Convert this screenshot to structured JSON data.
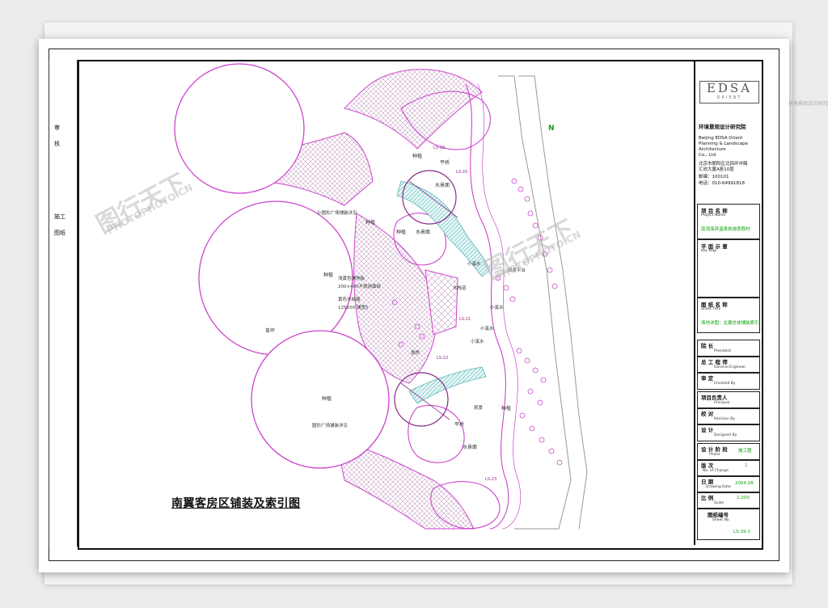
{
  "drawing": {
    "title": "南翼客房区铺装及索引图",
    "north": "N",
    "labels": {
      "plant1": "种植",
      "plant2": "种植",
      "plant3": "种植",
      "plant4": "种植",
      "plant5": "种植",
      "plant6": "种植",
      "water1": "水景面",
      "water2": "水景面",
      "water3": "水景面",
      "platform1": "平桥",
      "platform2": "平桥",
      "detail1": "小圆形广场铺装详见",
      "detail2": "圆形广场铺装详见",
      "note1": "浅黄色铺地板",
      "note2": "200×400不规则面砖",
      "note3": "黄色木板路",
      "note4": "125X50 铺宽5",
      "grass": "草坪",
      "stream1": "小溪水",
      "stream2": "小溪水",
      "stream3": "小溪水",
      "stream4": "小溪水",
      "wood": "木栈道",
      "overlook": "观景平台",
      "overlook2": "观景",
      "scenery": "景桥",
      "ref1": "LS-19",
      "ref2": "LS-20",
      "ref3": "LS-21",
      "ref4": "LS-22",
      "ref5": "LS-23"
    }
  },
  "titleblock": {
    "logo": "EDSA",
    "logo_sub": "ORIENT",
    "firm_cn": "环境景观设计研究院",
    "firm_en1": "Beijing EDSA Orient",
    "firm_en2": "Planning & Landscape",
    "firm_en3": "Architecture",
    "firm_en4": "Co., Ltd",
    "addr1": "北京市朝阳区北四环中路",
    "addr2": "汇欣大厦A座10层",
    "zip": "邮编：100101",
    "tel": "电话：010-64991818",
    "project_cn": "项 目 名 称",
    "project_en": "Project Name",
    "project_val": "南湾海滨温泉旅游度假村",
    "keymap_cn": "平 面 示 意",
    "keymap_en": "Key Map",
    "sheet_cn": "图 纸 名 称",
    "sheet_en": "Sheet Title",
    "sheet_val": "场地详图：北翼总体铺装索引",
    "president_cn": "院  长",
    "president_en": "President",
    "chief_cn": "总 工 程 师",
    "chief_en": "General Engineer",
    "review_cn": "审    定",
    "review_en": "Checked By",
    "principal_cn": "项目负责人",
    "principal_en": "Principal",
    "revision_cn": "校    对",
    "revision_en": "Revision By",
    "design_cn": "设    计",
    "design_en": "Designed By",
    "phase_cn": "设 计 阶 段",
    "phase_en": "Phase",
    "phase_val": "施工图",
    "change_cn": "版    次",
    "change_en": "No. of Change",
    "change_val": "1",
    "date_cn": "日    期",
    "date_en": "Drawing Date",
    "date_val": "2004.08",
    "scale_cn": "比    例",
    "scale_en": "Scale",
    "scale_val": "1:200",
    "sheetno_cn": "图纸编号",
    "sheetno_en": "Sheet No.",
    "sheetno_val": "LS-39-1"
  },
  "leftstrip": {
    "mark1": "审",
    "mark2": "核",
    "mark3": "施工",
    "mark4": "图纸"
  },
  "watermark": {
    "text1": "图行天下",
    "text2": "PHOTOPHOTO.CN"
  },
  "colors": {
    "line": "#cc44cc",
    "dark": "#8a2a8a",
    "accent": "#10a010",
    "cyan": "#4aa8a8"
  }
}
